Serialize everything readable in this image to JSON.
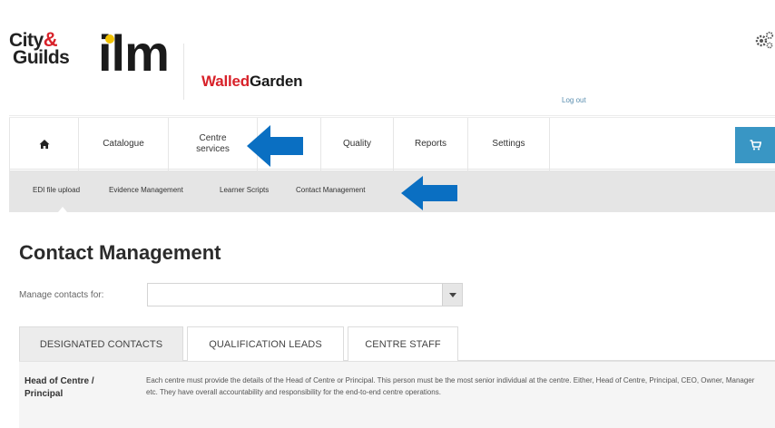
{
  "header": {
    "logo_city": "City",
    "logo_amp": "&",
    "logo_guilds": "Guilds",
    "logo_ilm": "ilm",
    "brand_walled": "Walled",
    "brand_garden": "Garden",
    "logout_label": "Log out",
    "gear_icon": "gear-icon"
  },
  "nav": {
    "home_icon": "home-icon",
    "items": [
      {
        "label": "Catalogue"
      },
      {
        "label": "Centre\nservices"
      },
      {
        "label": ""
      },
      {
        "label": "Quality"
      },
      {
        "label": "Reports"
      },
      {
        "label": "Settings"
      }
    ],
    "cart_icon": "cart-icon"
  },
  "subnav": {
    "items": [
      {
        "label": "EDI file upload"
      },
      {
        "label": "Evidence Management"
      },
      {
        "label": "Learner Scripts"
      },
      {
        "label": "Contact Management"
      }
    ]
  },
  "main": {
    "title": "Contact Management",
    "manage_label": "Manage contacts for:",
    "select_value": "",
    "tabs": [
      {
        "label": "DESIGNATED CONTACTS"
      },
      {
        "label": "QUALIFICATION LEADS"
      },
      {
        "label": "CENTRE STAFF"
      }
    ],
    "info_label": "Head of Centre / Principal",
    "info_text": "Each centre must provide the details of the Head of Centre or Principal. This person must be the most senior individual at the centre. Either, Head of Centre, Principal, CEO, Owner, Manager etc. They have overall accountability and responsibility for the end-to-end centre operations."
  },
  "colors": {
    "accent_blue": "#3996c4",
    "arrow_blue": "#0a6fc2",
    "brand_red": "#d8222a"
  }
}
